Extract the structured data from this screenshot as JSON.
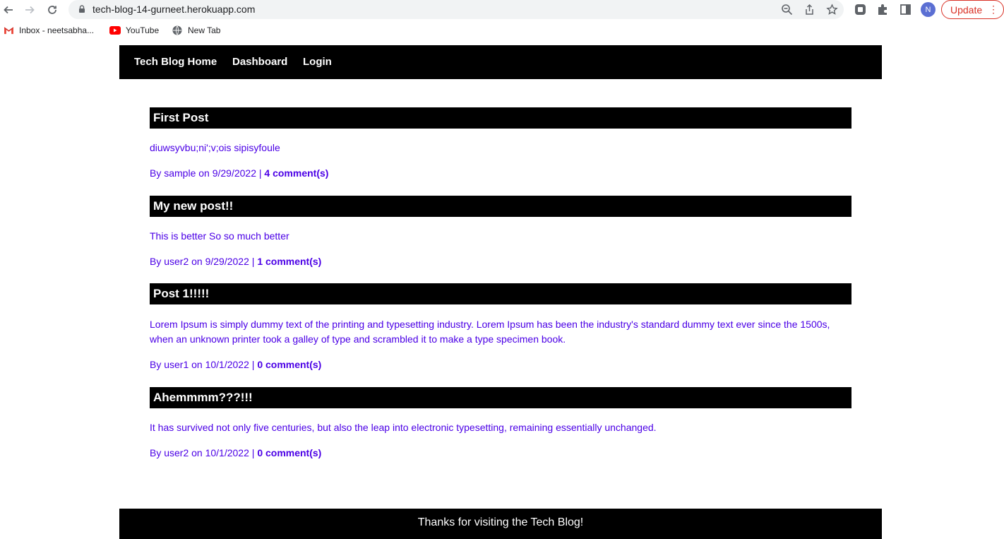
{
  "browser": {
    "url": "tech-blog-14-gurneet.herokuapp.com",
    "profile_initial": "N",
    "update_label": "Update",
    "bookmarks": [
      {
        "label": "Inbox - neetsabha...",
        "icon": "gmail-icon"
      },
      {
        "label": "YouTube",
        "icon": "youtube-icon"
      },
      {
        "label": "New Tab",
        "icon": "globe-icon"
      }
    ]
  },
  "site": {
    "nav": {
      "home": "Tech Blog Home",
      "dashboard": "Dashboard",
      "login": "Login"
    },
    "posts": [
      {
        "title": "First Post",
        "body": "diuwsyvbu;ni';v;ois sipisyfoule",
        "meta_prefix": "By sample on 9/29/2022 |",
        "comments": "4 comment(s)"
      },
      {
        "title": "My new post!!",
        "body": "This is better So so much better",
        "meta_prefix": "By user2 on 9/29/2022 |",
        "comments": "1 comment(s)"
      },
      {
        "title": "Post 1!!!!!",
        "body": "Lorem Ipsum is simply dummy text of the printing and typesetting industry. Lorem Ipsum has been the industry's standard dummy text ever since the 1500s, when an unknown printer took a galley of type and scrambled it to make a type specimen book.",
        "meta_prefix": "By user1 on 10/1/2022 |",
        "comments": "0 comment(s)"
      },
      {
        "title": "Ahemmmm???!!!",
        "body": "It has survived not only five centuries, but also the leap into electronic typesetting, remaining essentially unchanged.",
        "meta_prefix": "By user2 on 10/1/2022 |",
        "comments": "0 comment(s)"
      }
    ],
    "footer": "Thanks for visiting the Tech Blog!"
  },
  "colors": {
    "link": "#4b00e6",
    "bar": "#000000",
    "update": "#d93025"
  }
}
